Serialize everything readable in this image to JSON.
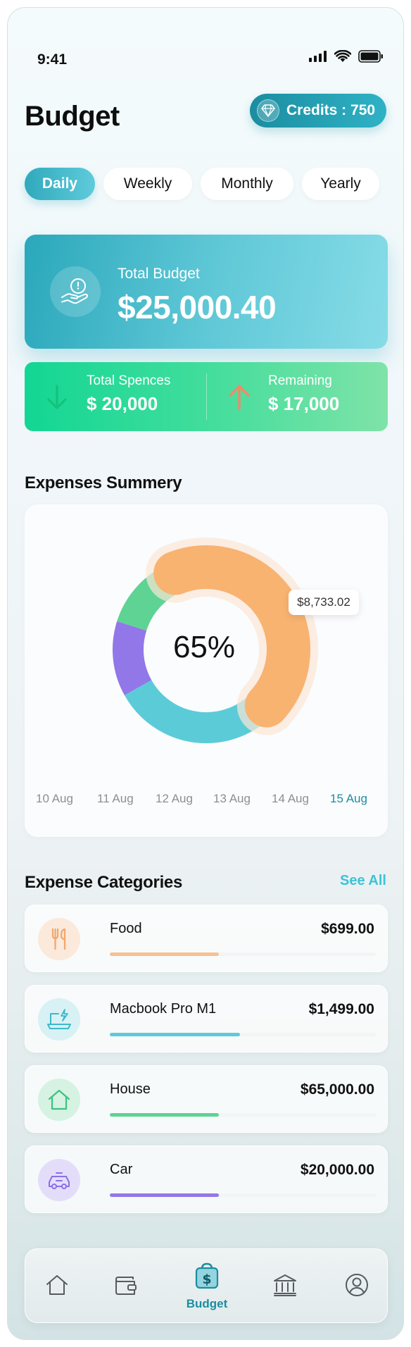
{
  "status_bar": {
    "time": "9:41",
    "icons": [
      "signal-icon",
      "wifi-icon",
      "battery-icon"
    ]
  },
  "header": {
    "title": "Budget",
    "credits": "Credits : 750",
    "credits_icon": "diamond-icon"
  },
  "tabs": [
    {
      "label": "Daily",
      "active": true
    },
    {
      "label": "Weekly",
      "active": false
    },
    {
      "label": "Monthly",
      "active": false
    },
    {
      "label": "Yearly",
      "active": false
    }
  ],
  "total_budget": {
    "label": "Total Budget",
    "amount": "$25,000.40",
    "icon": "hand-coin-icon"
  },
  "stats": {
    "spent_label": "Total Spences",
    "spent_value": "$ 20,000",
    "remaining_label": "Remaining",
    "remaining_value": "$ 17,000"
  },
  "summary": {
    "title": "Expenses Summery",
    "center_text": "65%",
    "tooltip": "$8,733.02",
    "days": [
      "10 Aug",
      "11 Aug",
      "12 Aug",
      "13 Aug",
      "14 Aug",
      "15 Aug"
    ],
    "active_day": "15 Aug"
  },
  "chart_data": {
    "type": "pie",
    "segments": [
      {
        "color": "#f8b371",
        "share": 0.43
      },
      {
        "color": "#5ccbd8",
        "share": 0.3
      },
      {
        "color": "#9277e9",
        "share": 0.13
      },
      {
        "color": "#5fd393",
        "share": 0.14
      }
    ],
    "center_label": "65%",
    "highlight_value": "$8,733.02"
  },
  "categories_section": {
    "title": "Expense Categories",
    "see_all": "See All"
  },
  "categories": [
    {
      "name": "Food",
      "amount": "$699.00",
      "progress": 0.41,
      "color": "#f5c193",
      "icon_bg": "#fbe9dc",
      "icon": "fork-knife-icon"
    },
    {
      "name": "Macbook Pro M1",
      "amount": "$1,499.00",
      "progress": 0.49,
      "color": "#5ccbd8",
      "icon_bg": "#d7f1f4",
      "icon": "laptop-icon"
    },
    {
      "name": "House",
      "amount": "$65,000.00",
      "progress": 0.41,
      "color": "#5fd393",
      "icon_bg": "#d6f2e2",
      "icon": "house-icon"
    },
    {
      "name": "Car",
      "amount": "$20,000.00",
      "progress": 0.41,
      "color": "#9277e9",
      "icon_bg": "#e4ddfa",
      "icon": "car-icon"
    }
  ],
  "nav": {
    "items": [
      "home-icon",
      "wallet-icon",
      "budget-icon",
      "bank-icon",
      "profile-icon"
    ],
    "active_label": "Budget"
  },
  "colors": {
    "accent": "#1b8da0",
    "accent_light": "#3dc3d6",
    "green": "#13d694"
  }
}
